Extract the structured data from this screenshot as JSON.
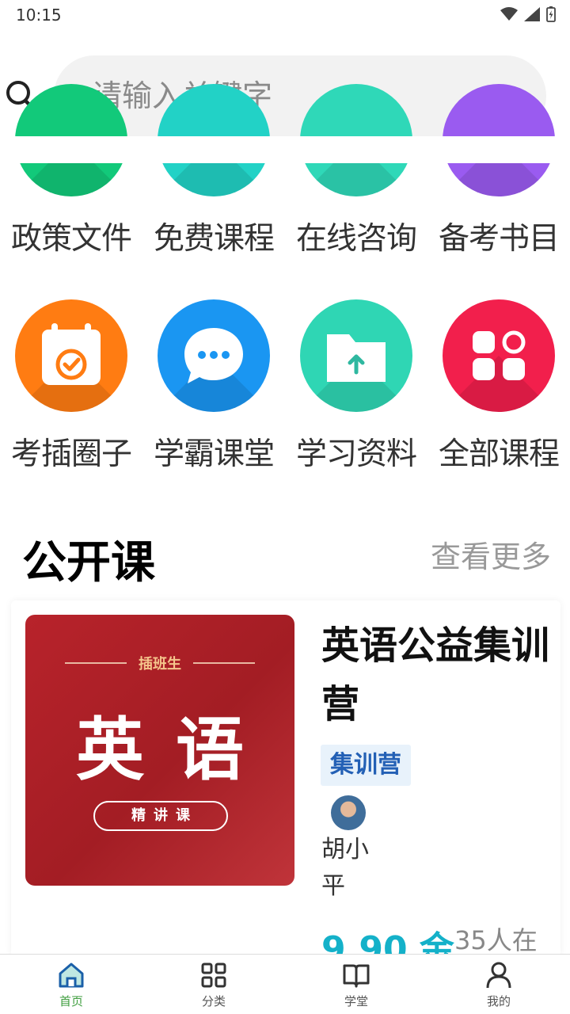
{
  "status_bar": {
    "time": "10:15"
  },
  "search": {
    "placeholder": "请输入关键字"
  },
  "grid": {
    "row1": [
      {
        "label": "政策文件",
        "icon": "policy-icon",
        "color": "#12c97a"
      },
      {
        "label": "免费课程",
        "icon": "free-course-icon",
        "color": "#22d2c6"
      },
      {
        "label": "在线咨询",
        "icon": "consult-icon",
        "color": "#2fd8b8"
      },
      {
        "label": "备考书目",
        "icon": "book-list-icon",
        "color": "#9a5bf0"
      }
    ],
    "row2": [
      {
        "label": "考插圈子",
        "icon": "calendar-check-icon",
        "color": "#ff7c12"
      },
      {
        "label": "学霸课堂",
        "icon": "chat-bubble-icon",
        "color": "#1a96f2"
      },
      {
        "label": "学习资料",
        "icon": "folder-upload-icon",
        "color": "#2fd6b4"
      },
      {
        "label": "全部课程",
        "icon": "apps-grid-icon",
        "color": "#f21f4c"
      }
    ]
  },
  "section": {
    "title": "公开课",
    "more": "查看更多"
  },
  "course": {
    "cover_sub": "插班生",
    "cover_main": "英语",
    "cover_pill": "精讲课",
    "title": "英语公益集训营",
    "tag": "集训营",
    "teacher": "胡小平",
    "price": "9.90 金",
    "students": "35人在"
  },
  "nav": [
    {
      "label": "首页",
      "icon": "home-icon",
      "active": true
    },
    {
      "label": "分类",
      "icon": "category-grid-icon"
    },
    {
      "label": "学堂",
      "icon": "open-book-icon"
    },
    {
      "label": "我的",
      "icon": "user-icon"
    }
  ],
  "colors": {
    "accent": "#3f9e3f",
    "price": "#14b1c9",
    "tag_text": "#2360b5"
  }
}
